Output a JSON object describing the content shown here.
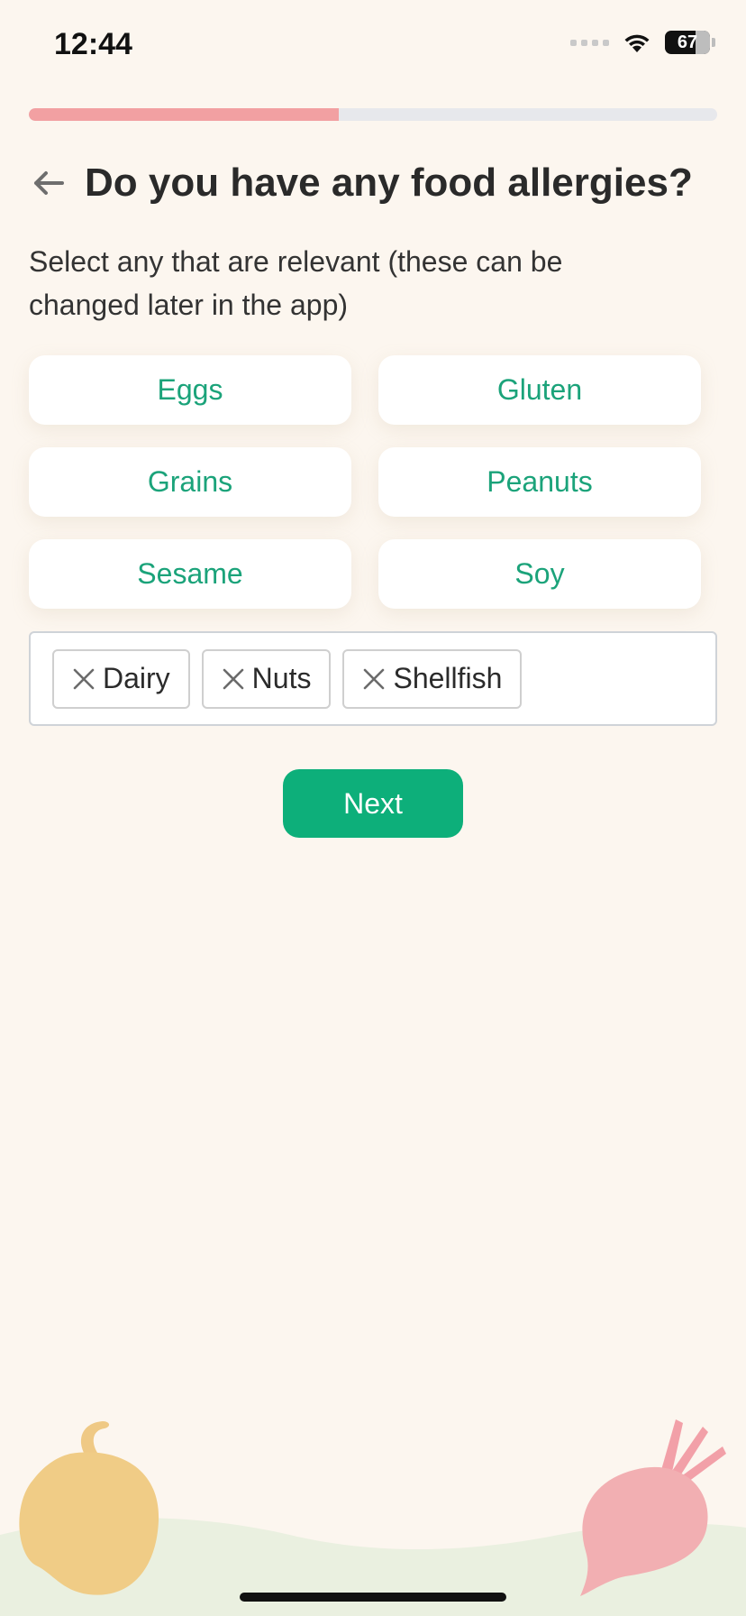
{
  "status_bar": {
    "time": "12:44",
    "battery": "67",
    "icons": [
      "signal-icon",
      "wifi-icon",
      "battery-icon"
    ]
  },
  "progress": {
    "value": 0.45,
    "fill_color": "#F2A0A2",
    "track_color": "#E7E8EC"
  },
  "header": {
    "back_icon": "arrow-left-icon",
    "title": "Do you have any food allergies?"
  },
  "subtitle": "Select any that are relevant (these can be changed later in the app)",
  "options": [
    {
      "label": "Eggs"
    },
    {
      "label": "Gluten"
    },
    {
      "label": "Grains"
    },
    {
      "label": "Peanuts"
    },
    {
      "label": "Sesame"
    },
    {
      "label": "Soy"
    }
  ],
  "selected": [
    {
      "label": "Dairy",
      "icon": "close-icon"
    },
    {
      "label": "Nuts",
      "icon": "close-icon"
    },
    {
      "label": "Shellfish",
      "icon": "close-icon"
    }
  ],
  "next_label": "Next",
  "colors": {
    "accent": "#0DAF7A",
    "option_text": "#1BA37A",
    "background": "#FCF6EF"
  },
  "decorations": [
    "bell-pepper-illustration",
    "beet-illustration"
  ]
}
